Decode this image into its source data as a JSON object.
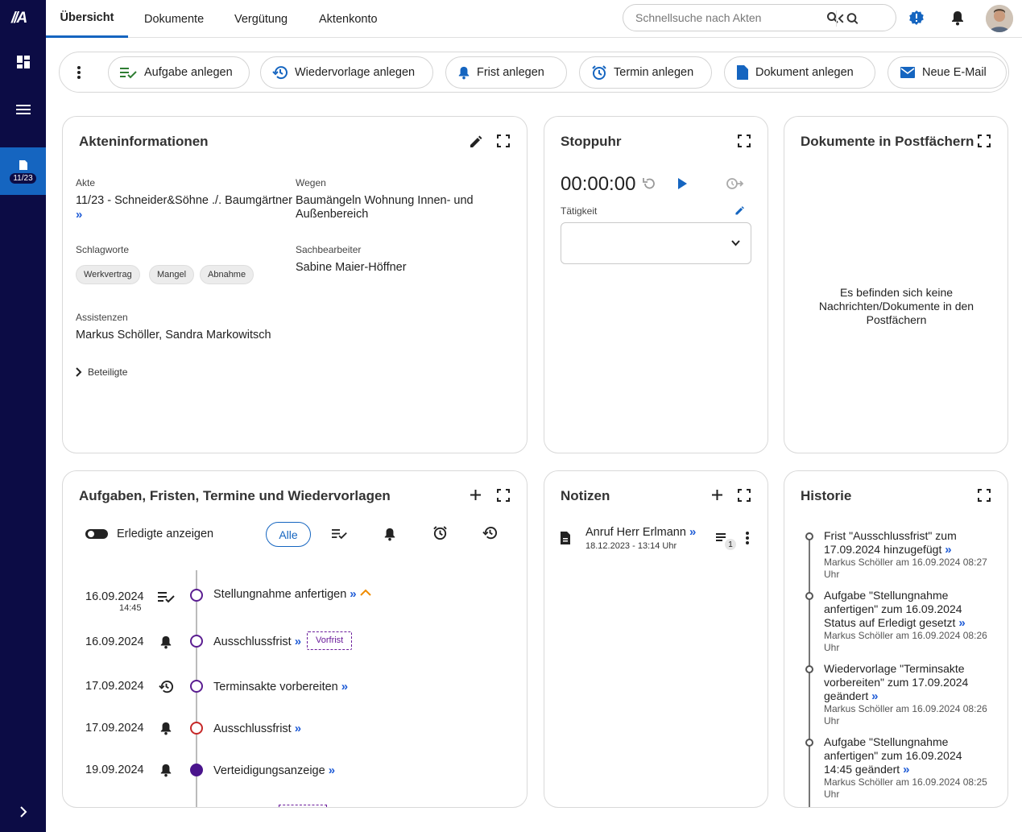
{
  "sidebar": {
    "logo": "//A",
    "active_badge": "11/23"
  },
  "header": {
    "tabs": [
      "Übersicht",
      "Dokumente",
      "Vergütung",
      "Aktenkonto"
    ],
    "search_placeholder": "Schnellsuche nach Akten"
  },
  "actions": {
    "items": [
      {
        "label": "Aufgabe anlegen",
        "icon": "task-check-icon"
      },
      {
        "label": "Wiedervorlage anlegen",
        "icon": "history-icon"
      },
      {
        "label": "Frist anlegen",
        "icon": "bell-icon"
      },
      {
        "label": "Termin anlegen",
        "icon": "alarm-clock-icon"
      },
      {
        "label": "Dokument anlegen",
        "icon": "document-icon"
      },
      {
        "label": "Neue E-Mail",
        "icon": "mail-icon"
      }
    ]
  },
  "akteninfo": {
    "title": "Akteninformationen",
    "akte_label": "Akte",
    "akte_value": "11/23 - Schneider&Söhne ./. Baumgärtner",
    "wegen_label": "Wegen",
    "wegen_value": "Baumängeln Wohnung Innen- und Außenbereich",
    "schlagworte_label": "Schlagworte",
    "schlagworte": [
      "Werkvertrag",
      "Mangel",
      "Abnahme"
    ],
    "sachbearbeiter_label": "Sachbearbeiter",
    "sachbearbeiter_value": "Sabine Maier-Höffner",
    "assistenzen_label": "Assistenzen",
    "assistenzen_value": "Markus Schöller, Sandra Markowitsch",
    "beteiligte_label": "Beteiligte"
  },
  "stoppuhr": {
    "title": "Stoppuhr",
    "time": "00:00:00",
    "taetigkeit_label": "Tätigkeit"
  },
  "postfaecher": {
    "title": "Dokumente in Postfächern",
    "empty_text": "Es befinden sich keine Nachrichten/Dokumente in den Postfächern"
  },
  "aufgaben": {
    "title": "Aufgaben, Fristen, Termine und Wiedervorlagen",
    "toggle_label": "Erledigte anzeigen",
    "filter_all": "Alle",
    "rows": [
      {
        "date": "16.09.2024",
        "sub": "14:45",
        "text": "Stellungnahme anfertigen",
        "icon": "task-check-icon",
        "circle": "open"
      },
      {
        "date": "16.09.2024",
        "sub": "",
        "text": "Ausschlussfrist",
        "icon": "bell-icon",
        "circle": "open",
        "tag": "Vorfrist"
      },
      {
        "date": "17.09.2024",
        "sub": "",
        "text": "Terminsakte vorbereiten",
        "icon": "history-icon",
        "circle": "open"
      },
      {
        "date": "17.09.2024",
        "sub": "",
        "text": "Ausschlussfrist",
        "icon": "bell-icon",
        "circle": "red"
      },
      {
        "date": "19.09.2024",
        "sub": "",
        "text": "Verteidigungsanzeige",
        "icon": "bell-icon",
        "circle": "filled"
      }
    ]
  },
  "notizen": {
    "title": "Notizen",
    "items": [
      {
        "title": "Anruf Herr Erlmann",
        "date": "18.12.2023 - 13:14 Uhr",
        "count": "1"
      }
    ]
  },
  "historie": {
    "title": "Historie",
    "entries": [
      {
        "text": "Frist \"Ausschlussfrist\" zum 17.09.2024 hinzugefügt",
        "meta": "Markus Schöller am 16.09.2024 08:27 Uhr"
      },
      {
        "text": "Aufgabe \"Stellungnahme anfertigen\" zum 16.09.2024 Status auf Erledigt gesetzt",
        "meta": "Markus Schöller am 16.09.2024 08:26 Uhr"
      },
      {
        "text": "Wiedervorlage \"Terminsakte vorbereiten\" zum 17.09.2024 geändert",
        "meta": "Markus Schöller am 16.09.2024 08:26 Uhr"
      },
      {
        "text": "Aufgabe \"Stellungnahme anfertigen\" zum 16.09.2024 14:45 geändert",
        "meta": "Markus Schöller am 16.09.2024 08:25 Uhr"
      }
    ]
  },
  "colors": {
    "sidebar": "#0c0c45",
    "accent": "#1565c0",
    "link": "#1e5bd6",
    "purple": "#4a148c",
    "red": "#c62828"
  }
}
